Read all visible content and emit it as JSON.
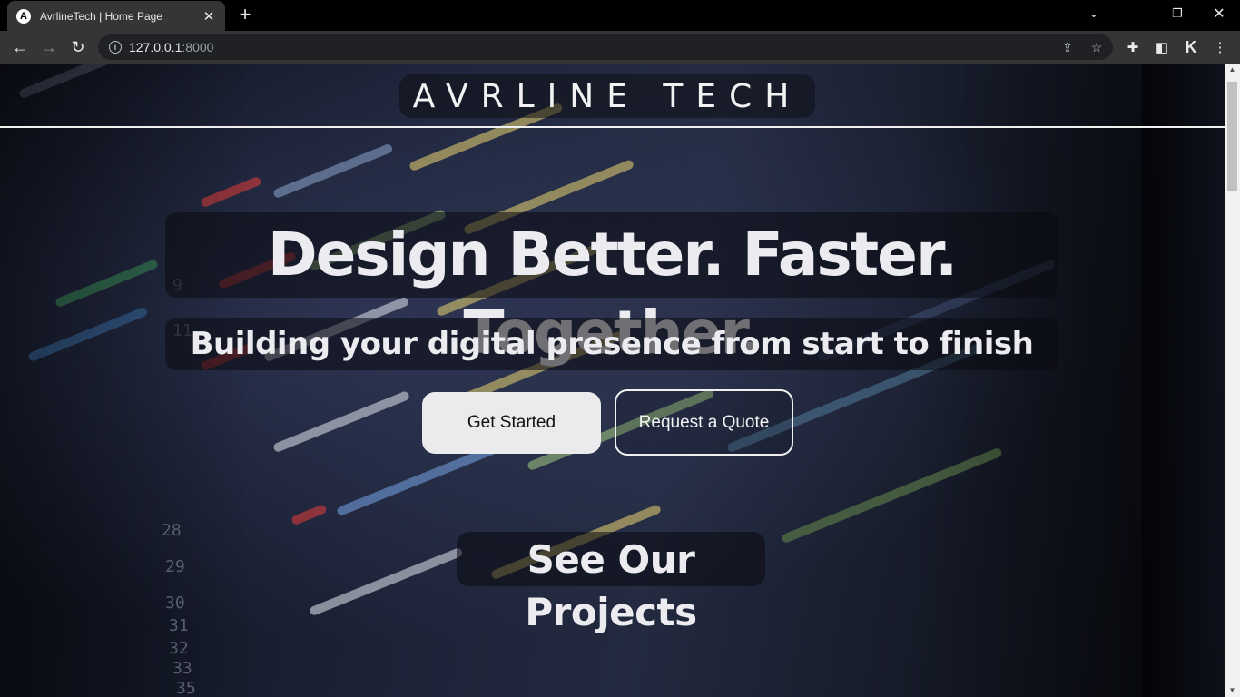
{
  "browser": {
    "tab_title": "AvrlineTech | Home Page",
    "tab_favicon": "A",
    "url_host": "127.0.0.1",
    "url_port": ":8000"
  },
  "site": {
    "brand": "AVRLINE TECH",
    "hero_title": "Design Better. Faster. Together.",
    "hero_subtitle": "Building your digital presence from start to finish",
    "primary_button": "Get Started",
    "secondary_button": "Request a Quote",
    "projects_heading": "See Our Projects"
  },
  "colors": {
    "tab_bg": "#353535",
    "omnibox_bg": "#202124",
    "primary_button_bg": "#ebebee",
    "text_light": "#ececf0"
  }
}
